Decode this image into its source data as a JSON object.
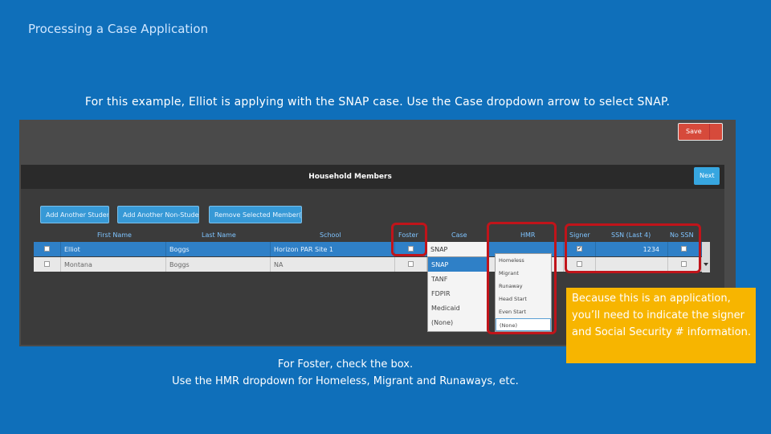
{
  "slide": {
    "title": "Processing a Case Application",
    "instruction": "For this example, Elliot is applying with the SNAP case. Use the Case dropdown arrow to select SNAP.",
    "callout": "Because this is an application, you’ll need to indicate the signer and Social Security # information.",
    "caption_line1": "For Foster, check the box.",
    "caption_line2": "Use the HMR dropdown for Homeless, Migrant and Runaways, etc."
  },
  "app": {
    "save_label": "Save",
    "panel_title": "Household Members",
    "next_label": "Next",
    "buttons": [
      "Add Another Student",
      "Add Another Non-Student",
      "Remove Selected Member(s)"
    ],
    "columns": [
      "First Name",
      "Last Name",
      "School",
      "Foster",
      "Case",
      "HMR",
      "Signer",
      "SSN (Last 4)",
      "No SSN"
    ],
    "rows": [
      {
        "first_name": "Elliot",
        "last_name": "Boggs",
        "school": "Horizon PAR Site 1",
        "case": "SNAP",
        "signer": true,
        "ssn": "1234"
      },
      {
        "first_name": "Montana",
        "last_name": "Boggs",
        "school": "NA",
        "case": "",
        "signer": false,
        "ssn": ""
      }
    ],
    "case_options": [
      "SNAP",
      "TANF",
      "FDPIR",
      "Medicaid",
      "(None)"
    ],
    "case_selected": "SNAP",
    "hmr_options": [
      "Homeless",
      "Migrant",
      "Runaway",
      "Head Start",
      "Even Start",
      "(None)"
    ]
  },
  "colors": {
    "background": "#0f6fba",
    "highlight_box": "#c0141a",
    "callout": "#f7b500",
    "row_selected": "#2f80c7"
  }
}
